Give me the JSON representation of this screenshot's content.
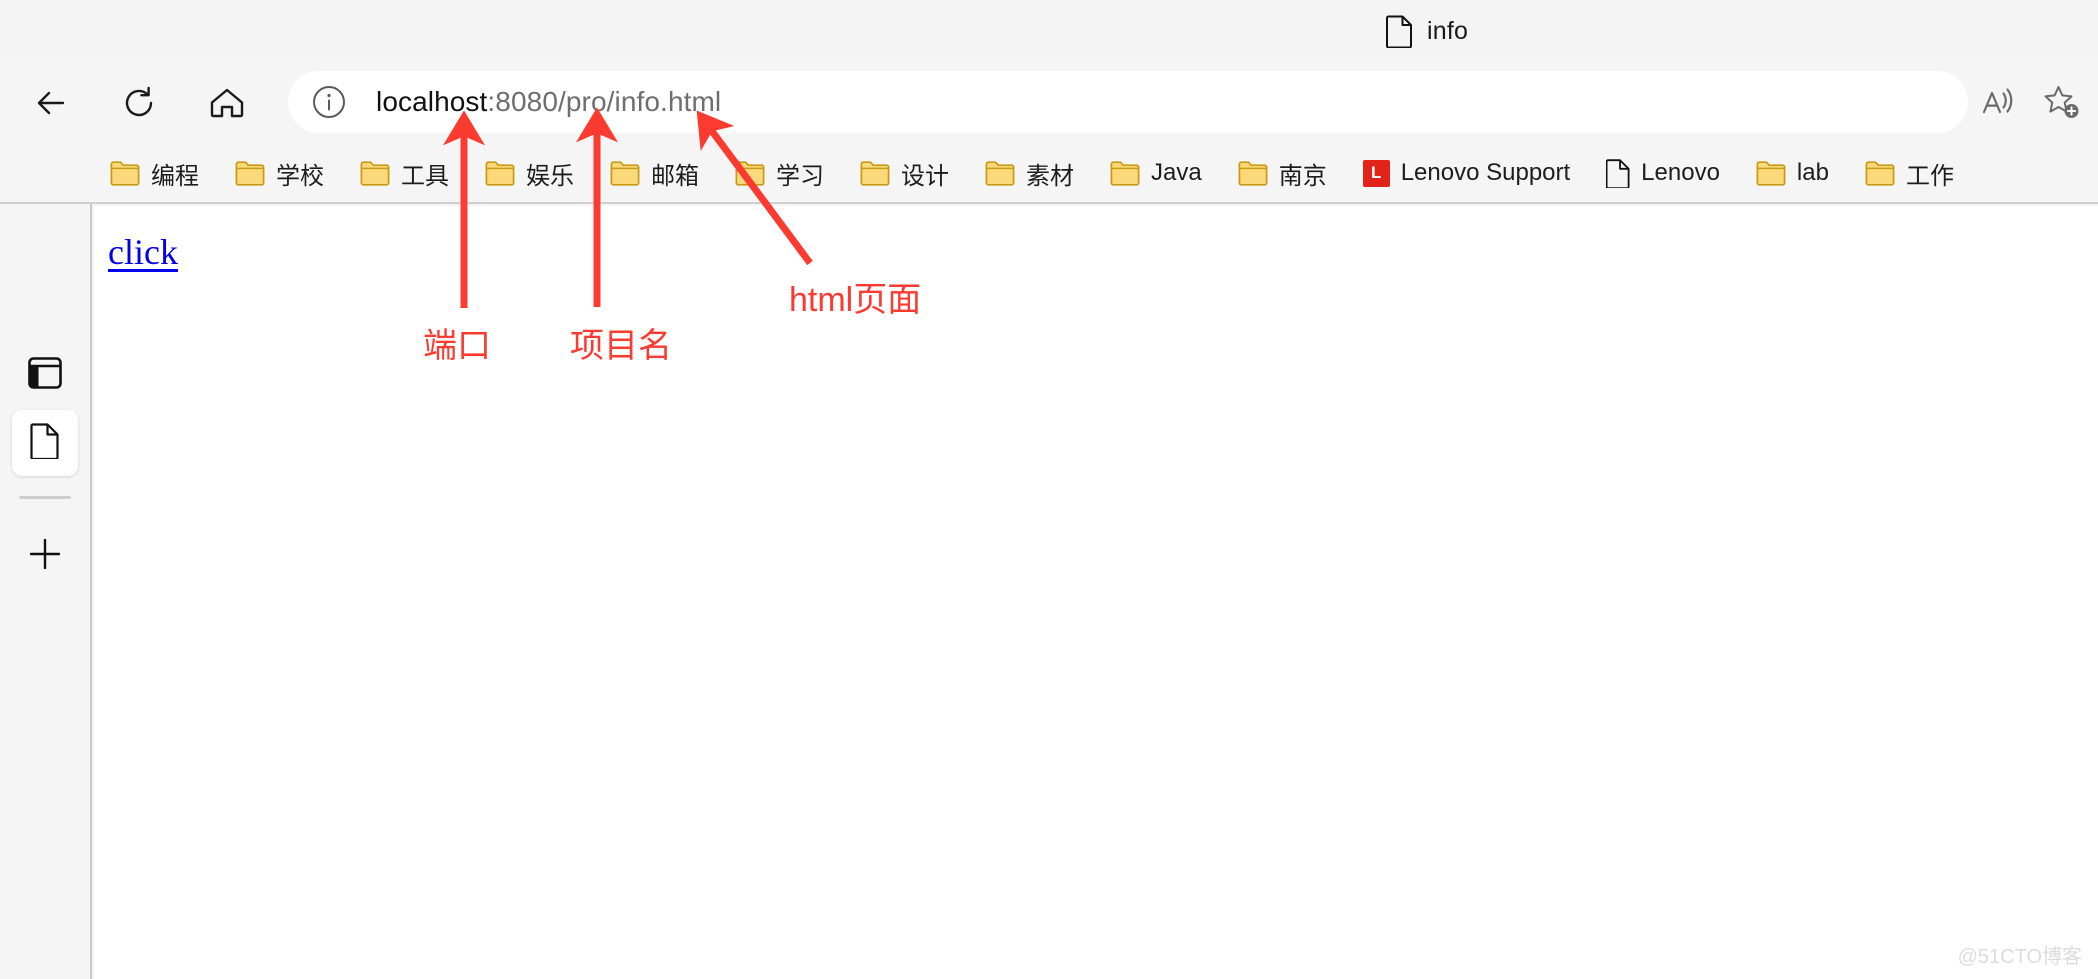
{
  "browser": {
    "tab": {
      "title": "info",
      "icon": "document-icon"
    },
    "toolbar": {
      "back_icon": "back-arrow-icon",
      "reload_icon": "reload-icon",
      "home_icon": "home-icon",
      "read_aloud_icon": "read-aloud-icon",
      "favorite_icon": "add-favorite-star-icon"
    },
    "omnibox": {
      "info_icon": "site-info-icon",
      "url_full": "localhost:8080/pro/info.html",
      "url_host": "localhost",
      "url_path": ":8080/pro/info.html"
    },
    "bookmarks": [
      {
        "label": "编程",
        "icon": "folder-icon"
      },
      {
        "label": "学校",
        "icon": "folder-icon"
      },
      {
        "label": "工具",
        "icon": "folder-icon"
      },
      {
        "label": "娱乐",
        "icon": "folder-icon"
      },
      {
        "label": "邮箱",
        "icon": "folder-icon"
      },
      {
        "label": "学习",
        "icon": "folder-icon"
      },
      {
        "label": "设计",
        "icon": "folder-icon"
      },
      {
        "label": "素材",
        "icon": "folder-icon"
      },
      {
        "label": "Java",
        "icon": "folder-icon"
      },
      {
        "label": "南京",
        "icon": "folder-icon"
      },
      {
        "label": "Lenovo Support",
        "icon": "lenovo-l-icon"
      },
      {
        "label": "Lenovo",
        "icon": "document-icon"
      },
      {
        "label": "lab",
        "icon": "folder-icon"
      },
      {
        "label": "工作",
        "icon": "folder-icon"
      }
    ],
    "sidebar": [
      {
        "name": "vertical-tabs",
        "icon": "vertical-tabs-icon",
        "active": false
      },
      {
        "name": "page-tab",
        "icon": "document-icon",
        "active": true
      },
      {
        "name": "new-tab",
        "icon": "plus-icon",
        "active": false
      }
    ]
  },
  "page": {
    "link_label": "click"
  },
  "annotations": {
    "port": "端口",
    "project_name": "项目名",
    "html_page": "html页面",
    "arrow_color": "#fb3b30"
  },
  "watermark": "@51CTO博客"
}
